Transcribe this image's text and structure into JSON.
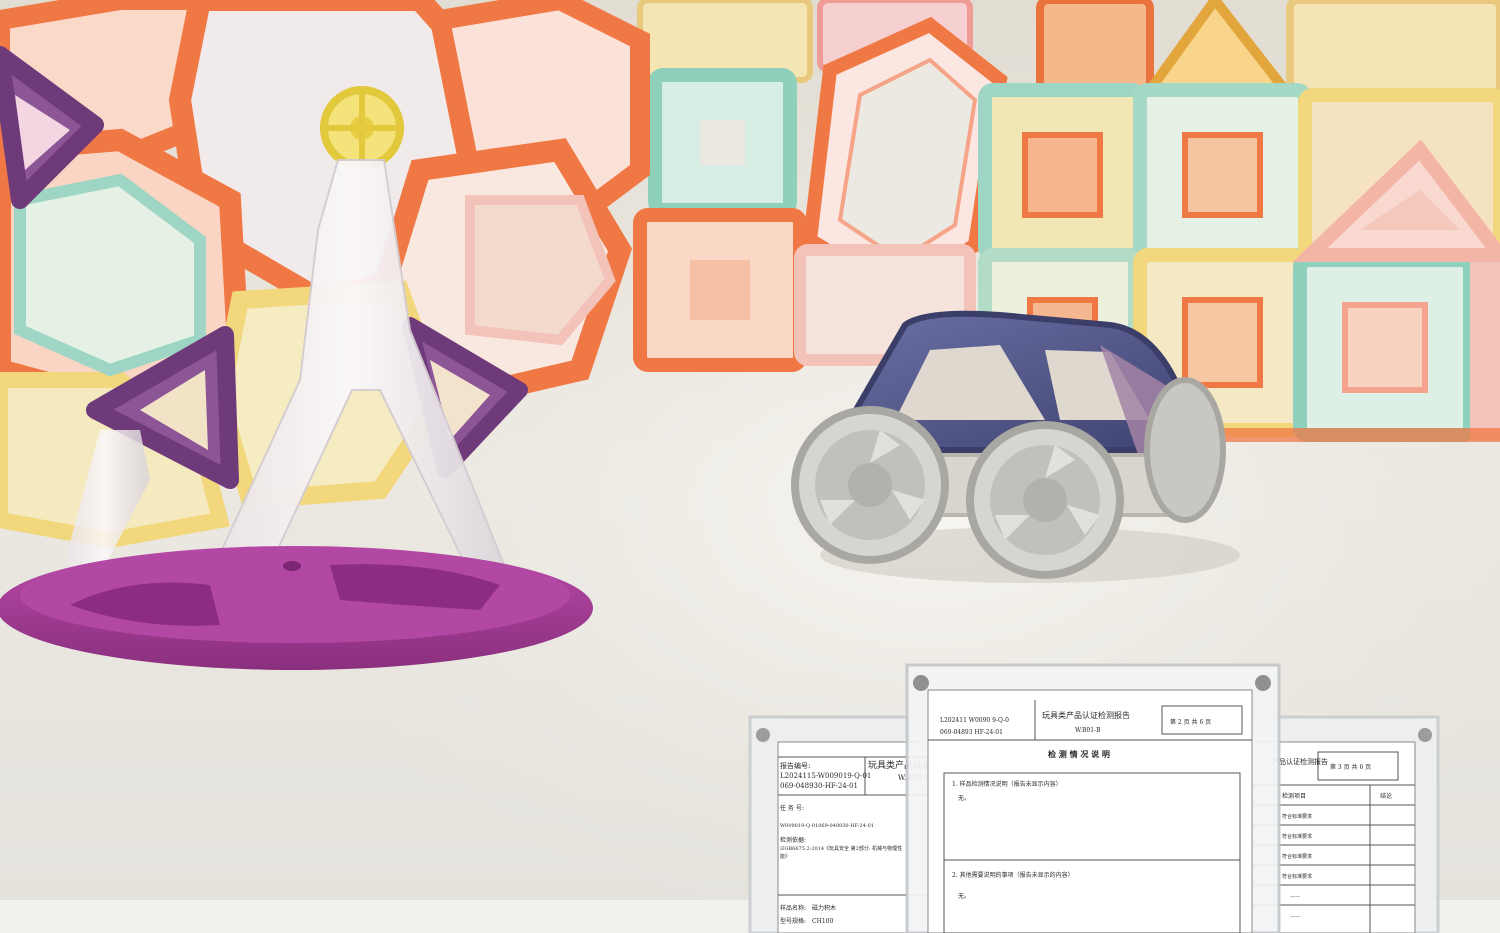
{
  "scene": {
    "objects": [
      "magnetic-tile-ferris-wheel",
      "magnetic-tile-toy-car",
      "magnetic-tile-wall",
      "certificate-frames"
    ],
    "colors": {
      "background": "#ebe8e1",
      "orange_tile": "#f07845",
      "purple_tile": "#6f3a7a",
      "green_tile": "#9fd5c4",
      "yellow_tile": "#f2d77c",
      "pink_tile": "#f3c2b8",
      "base_purple": "#a33a96",
      "car_navy": "#4f5486",
      "wheel_gray": "#c9c7c1"
    }
  },
  "documents": {
    "left": {
      "report_no_label": "报告编号:",
      "report_no_1": "L2024115-W009019-Q-01",
      "report_no_2": "069-048930-HF-24-01",
      "header_title": "玩具类产品认证",
      "header_sub": "W. B01-B",
      "task_label": "任 务 号:",
      "task_value": "W009019-Q-01069-048930-HF-24-01",
      "basis_label": "检测依据:",
      "basis_value": "☑GB6675.2-2014《玩具安全 第2部分: 机械与物理性",
      "basis_value_2": "能》",
      "sample_label": "样品名称:",
      "sample_value": "磁力积木",
      "model_label": "型号规格:",
      "model_value": "CH100"
    },
    "center": {
      "report_line_1": "L202411 W0090 9-Q-0",
      "report_line_2": "069-04893 HF-24-01",
      "header_title": "玩具类产品认证检测报告",
      "header_sub": "W.B01-B",
      "page_box": "第 2 页 共 6 页",
      "section_title": "检 测 情 况 说 明",
      "item_1": "1. 样品检测情况说明（报告未显示内容）",
      "item_1_sub": "无。",
      "item_2": "2. 其他需要说明的事项（报告未显示的内容）",
      "item_2_sub": "无。"
    },
    "right": {
      "header_title": "产品认证检测报告",
      "page_box": "第 3 页 共 6 页",
      "col_1": "检测项目",
      "col_2": "结论",
      "rows": [
        "符合标准要求",
        "符合标准要求",
        "符合标准要求",
        "符合标准要求",
        "——",
        "——"
      ]
    }
  }
}
